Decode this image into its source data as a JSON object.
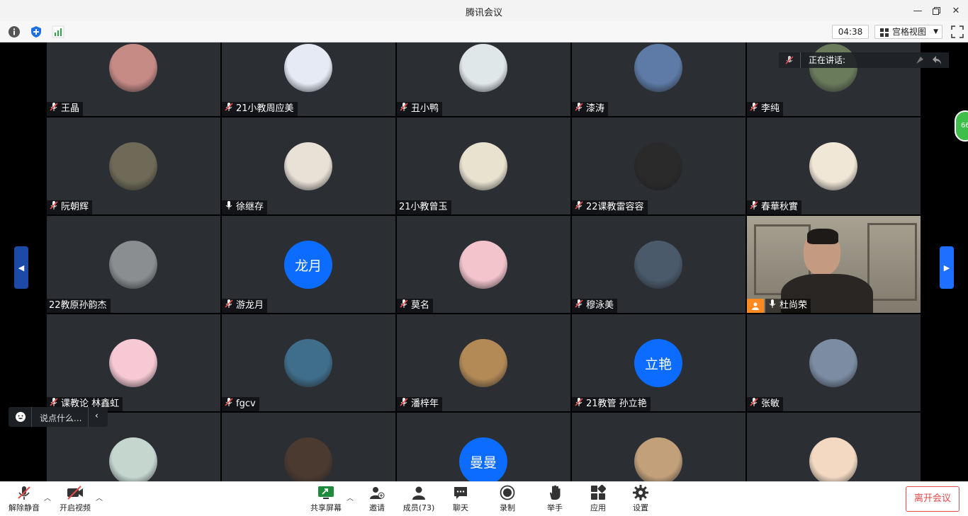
{
  "window": {
    "title": "腾讯会议"
  },
  "toolbar": {
    "timer": "04:38",
    "view_label": "宫格视图"
  },
  "speaking": {
    "label": "正在讲话:"
  },
  "right_badge": "66",
  "chat": {
    "placeholder": "说点什么..."
  },
  "tiles": [
    {
      "name": "王晶",
      "mic": "muted",
      "avatar": "photo",
      "color": "#c78b86"
    },
    {
      "name": "21小教周应美",
      "mic": "muted",
      "avatar": "photo",
      "color": "#e6eaf5"
    },
    {
      "name": "丑小鸭",
      "mic": "muted",
      "avatar": "photo",
      "color": "#dfe7e9"
    },
    {
      "name": "漆涛",
      "mic": "muted",
      "avatar": "photo",
      "color": "#5d7ba6"
    },
    {
      "name": "李纯",
      "mic": "muted",
      "avatar": "photo",
      "color": "#6a7b5c"
    },
    {
      "name": "阮朝辉",
      "mic": "muted",
      "avatar": "photo",
      "color": "#6e6a57"
    },
    {
      "name": "徐继存",
      "mic": "on",
      "avatar": "photo",
      "color": "#e8e1d6"
    },
    {
      "name": "21小教曾玉",
      "mic": "none",
      "avatar": "photo",
      "color": "#e8e2cf"
    },
    {
      "name": "22课教雷容容",
      "mic": "muted",
      "avatar": "photo",
      "color": "#2a2a2a"
    },
    {
      "name": "春華秋實",
      "mic": "muted",
      "avatar": "photo",
      "color": "#f1e7d6"
    },
    {
      "name": "22教原孙韵杰",
      "mic": "none",
      "avatar": "photo",
      "color": "#8a8e90"
    },
    {
      "name": "游龙月",
      "mic": "muted",
      "avatar": "text",
      "initials": "龙月"
    },
    {
      "name": "莫名",
      "mic": "muted",
      "avatar": "photo",
      "color": "#f4c4cc"
    },
    {
      "name": "穆泳美",
      "mic": "muted",
      "avatar": "photo",
      "color": "#4a5a6a"
    },
    {
      "name": "杜尚荣",
      "mic": "on",
      "avatar": "video",
      "color": "#8a8679"
    },
    {
      "name": "课教论 林鑫虹",
      "mic": "muted",
      "avatar": "photo",
      "color": "#f7c9d4"
    },
    {
      "name": "fgcv",
      "mic": "muted",
      "avatar": "photo",
      "color": "#3f6e8a"
    },
    {
      "name": "潘梓年",
      "mic": "muted",
      "avatar": "photo",
      "color": "#b38a56"
    },
    {
      "name": "21教管 孙立艳",
      "mic": "muted",
      "avatar": "text",
      "initials": "立艳"
    },
    {
      "name": "张敏",
      "mic": "muted",
      "avatar": "photo",
      "color": "#7c8da3"
    },
    {
      "name": "",
      "mic": "none",
      "avatar": "photo",
      "color": "#c5d6cf"
    },
    {
      "name": "",
      "mic": "none",
      "avatar": "photo",
      "color": "#4a3a30"
    },
    {
      "name": "",
      "mic": "none",
      "avatar": "text",
      "initials": "曼曼"
    },
    {
      "name": "",
      "mic": "none",
      "avatar": "photo",
      "color": "#c2a07a"
    },
    {
      "name": "",
      "mic": "none",
      "avatar": "photo",
      "color": "#f3d9c2"
    }
  ],
  "bottom": {
    "unmute": "解除静音",
    "video": "开启视频",
    "share": "共享屏幕",
    "invite": "邀请",
    "members": "成员(73)",
    "chat": "聊天",
    "record": "录制",
    "raise_hand": "举手",
    "apps": "应用",
    "settings": "设置",
    "leave": "离开会议"
  }
}
